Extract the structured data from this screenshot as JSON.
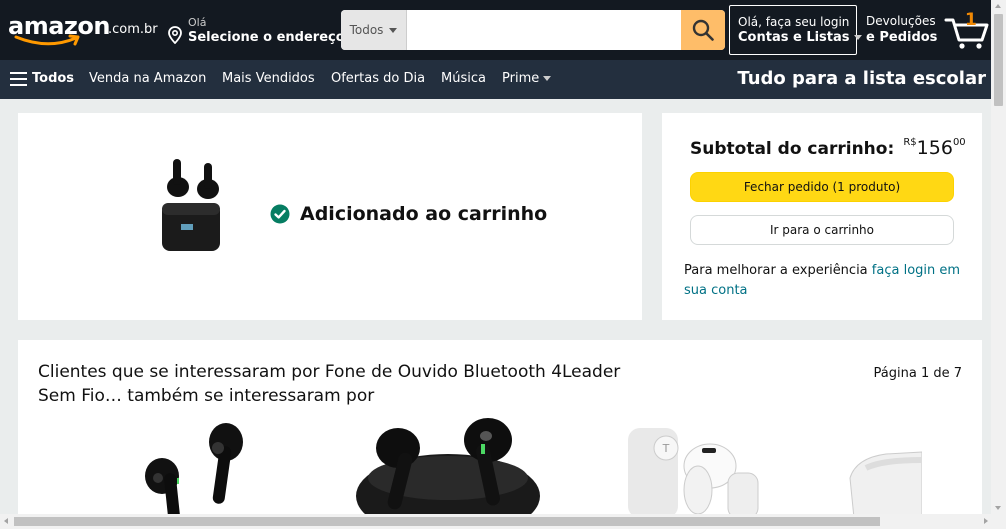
{
  "header": {
    "logo_text": "amazon",
    "logo_tld": ".com.br",
    "address": {
      "greeting": "Olá",
      "action": "Selecione o endereço"
    },
    "search": {
      "category": "Todos",
      "placeholder": ""
    },
    "account": {
      "greeting": "Olá, faça seu login",
      "label": "Contas e Listas"
    },
    "returns": {
      "line1": "Devoluções",
      "line2": "e Pedidos"
    },
    "cart": {
      "count": "1"
    }
  },
  "subnav": {
    "all_label": "Todos",
    "items": [
      "Venda na Amazon",
      "Mais Vendidos",
      "Ofertas do Dia",
      "Música",
      "Prime"
    ],
    "promo": "Tudo para a lista escolar"
  },
  "added": {
    "message": "Adicionado ao carrinho"
  },
  "subtotal": {
    "label": "Subtotal do carrinho:",
    "currency": "R$",
    "whole": "156",
    "fraction": "00",
    "checkout_button": "Fechar pedido (1 produto)",
    "cart_button": "Ir para o carrinho",
    "login_prefix": "Para melhorar a experiência ",
    "login_link": "faça login em sua conta"
  },
  "recommendations": {
    "title": "Clientes que se interessaram por Fone de Ouvido Bluetooth 4Leader Sem Fio… também se interessaram por",
    "page_indicator": "Página 1 de 7"
  },
  "colors": {
    "nav_dark": "#131921",
    "nav_sub": "#232f3e",
    "search_button": "#febd69",
    "checkout_yellow": "#ffd814",
    "link_teal": "#007185",
    "success_green": "#067d62",
    "cart_count_orange": "#f08804"
  }
}
